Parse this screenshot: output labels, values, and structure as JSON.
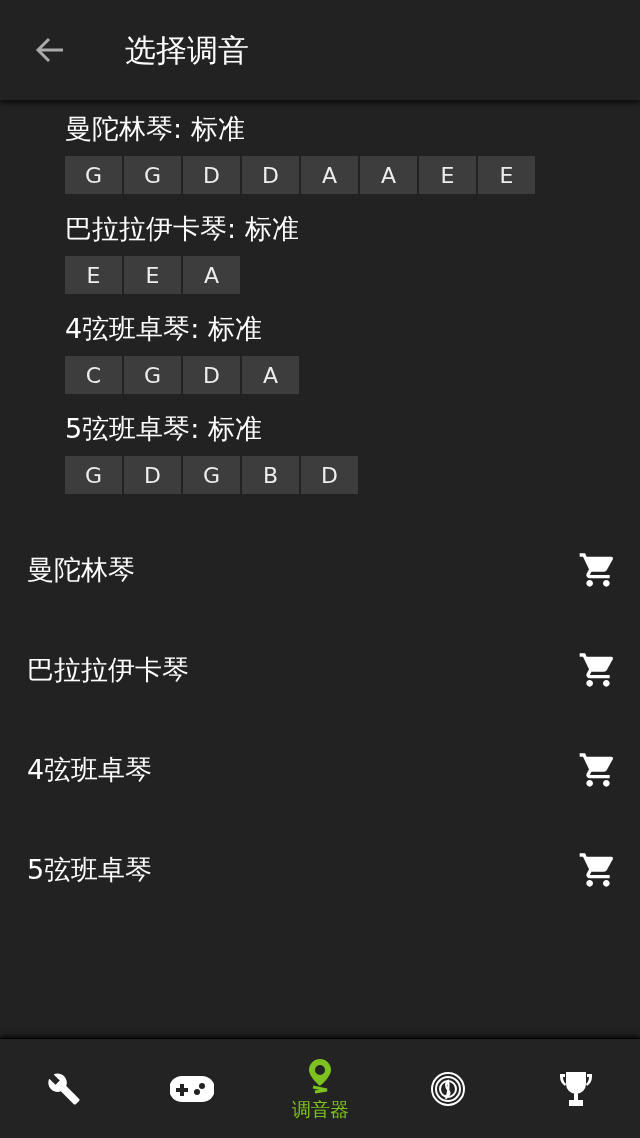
{
  "header": {
    "title": "选择调音"
  },
  "tunings": [
    {
      "title": "曼陀林琴: 标准",
      "notes": [
        "G",
        "G",
        "D",
        "D",
        "A",
        "A",
        "E",
        "E"
      ]
    },
    {
      "title": "巴拉拉伊卡琴: 标准",
      "notes": [
        "E",
        "E",
        "A"
      ]
    },
    {
      "title": "4弦班卓琴: 标准",
      "notes": [
        "C",
        "G",
        "D",
        "A"
      ]
    },
    {
      "title": "5弦班卓琴: 标准",
      "notes": [
        "G",
        "D",
        "G",
        "B",
        "D"
      ]
    }
  ],
  "instruments": [
    {
      "name": "曼陀林琴"
    },
    {
      "name": "巴拉拉伊卡琴"
    },
    {
      "name": "4弦班卓琴"
    },
    {
      "name": "5弦班卓琴"
    }
  ],
  "bottom_nav": [
    {
      "selected": false
    },
    {
      "selected": false
    },
    {
      "selected": true,
      "label": "调音器"
    },
    {
      "selected": false
    },
    {
      "selected": false
    }
  ]
}
